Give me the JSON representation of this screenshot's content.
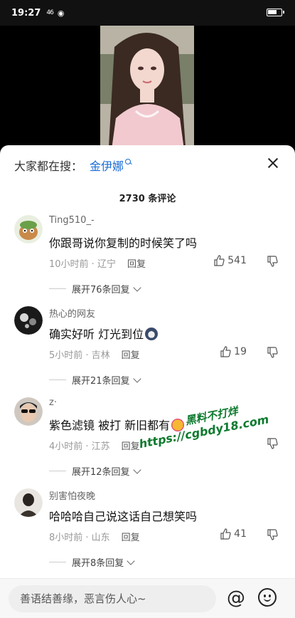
{
  "status_bar": {
    "time": "19:27",
    "signal": "46",
    "battery_level": 0.6
  },
  "search": {
    "prefix": "大家都在搜：",
    "term": "金伊娜"
  },
  "comments_header": {
    "count_label": "2730 条评论"
  },
  "comments": [
    {
      "username": "Ting510_-",
      "text": "你跟哥说你复制的时候笑了吗",
      "time": "10小时前 · 辽宁",
      "reply_label": "回复",
      "likes": "541",
      "expand_label": "展开76条回复"
    },
    {
      "username": "热心的网友",
      "text": "确实好听 灯光到位",
      "time": "5小时前 · 吉林",
      "reply_label": "回复",
      "likes": "19",
      "expand_label": "展开21条回复"
    },
    {
      "username": "z·",
      "text": "紫色滤镜 被打 新旧都有",
      "time": "4小时前 · 江苏",
      "reply_label": "回复",
      "likes": "",
      "expand_label": "展开12条回复"
    },
    {
      "username": "别害怕夜晚",
      "text": "哈哈哈自己说这话自己想笑吗",
      "time": "8小时前 · 山东",
      "reply_label": "回复",
      "likes": "41",
      "expand_label": "展开8条回复"
    }
  ],
  "watermark": {
    "line1": "黑料不打烊",
    "line2": "https://cgbdy18.com"
  },
  "input": {
    "placeholder": "善语结善缘，恶言伤人心~"
  },
  "colors": {
    "accent": "#1a6dd6",
    "watermark": "#0e7a2e"
  },
  "icons": [
    "search-icon",
    "close-icon",
    "thumb-up-icon",
    "thumb-down-icon",
    "chevron-down-icon",
    "at-icon",
    "emoji-icon"
  ]
}
